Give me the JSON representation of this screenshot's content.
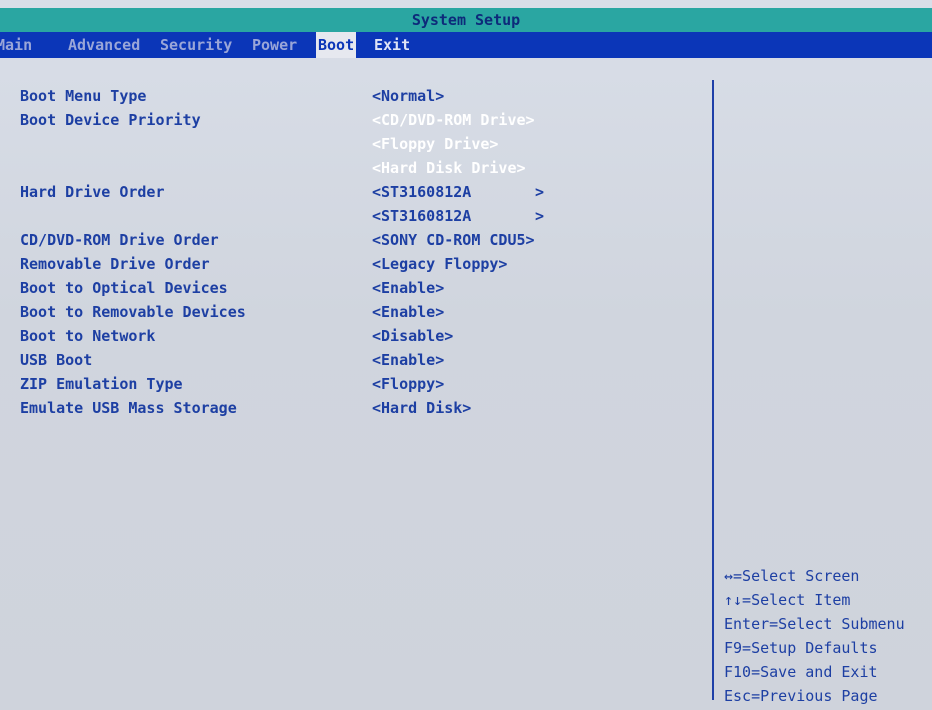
{
  "title": "System Setup",
  "menu": {
    "main": "Main",
    "advanced": "Advanced",
    "security": "Security",
    "power": "Power",
    "boot": "Boot",
    "exit": "Exit"
  },
  "settings": [
    {
      "label": "Boot Menu Type",
      "value": "<Normal>"
    },
    {
      "label": "Boot Device Priority",
      "value": "<CD/DVD-ROM Drive>"
    },
    {
      "label": "",
      "value": "<Floppy Drive>"
    },
    {
      "label": "",
      "value": "<Hard Disk Drive>"
    },
    {
      "label": "Hard Drive Order",
      "value": "<ST3160812A",
      "arrow": ">"
    },
    {
      "label": "",
      "value": "<ST3160812A",
      "arrow": ">"
    },
    {
      "label": "CD/DVD-ROM Drive Order",
      "value": "<SONY CD-ROM CDU5>"
    },
    {
      "label": "Removable Drive Order",
      "value": "<Legacy Floppy>"
    },
    {
      "label": "Boot to Optical Devices",
      "value": "<Enable>"
    },
    {
      "label": "Boot to Removable Devices",
      "value": "<Enable>"
    },
    {
      "label": "Boot to Network",
      "value": "<Disable>"
    },
    {
      "label": "USB Boot",
      "value": "<Enable>"
    },
    {
      "label": "ZIP Emulation Type",
      "value": "<Floppy>"
    },
    {
      "label": "Emulate USB Mass Storage",
      "value": "<Hard Disk>"
    }
  ],
  "help": [
    "↔=Select Screen",
    "↑↓=Select Item",
    "Enter=Select Submenu",
    "F9=Setup Defaults",
    "F10=Save and Exit",
    "Esc=Previous Page"
  ],
  "colors": {
    "title_bar": "#2aa6a2",
    "menu_bar": "#0b36b8",
    "text": "#1d3fa3",
    "highlight": "#ffffff",
    "background": "#d4d8e1"
  }
}
